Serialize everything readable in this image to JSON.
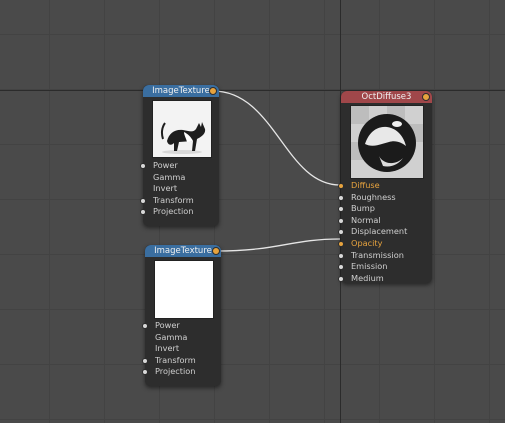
{
  "canvas": {
    "grid": true
  },
  "colors": {
    "texture_header": "#3a6ea0",
    "material_header": "#a0474a",
    "active_pin": "#e7a33e",
    "wire": "#e6e6e6"
  },
  "nodes": {
    "image_texture_1": {
      "title": "ImageTexture",
      "preview": "cat-photo-thumbnail",
      "pins": [
        "Power",
        "Gamma",
        "Invert",
        "Transform",
        "Projection"
      ]
    },
    "image_texture_2": {
      "title": "ImageTexture",
      "preview": "blank-white-thumbnail",
      "pins": [
        "Power",
        "Gamma",
        "Invert",
        "Transform",
        "Projection"
      ]
    },
    "oct_diffuse": {
      "title": "OctDiffuse3",
      "preview": "material-sphere-preview",
      "pins": [
        "Diffuse",
        "Roughness",
        "Bump",
        "Normal",
        "Displacement",
        "Opacity",
        "Transmission",
        "Emission",
        "Medium"
      ]
    }
  },
  "connections": [
    {
      "from": "ImageTexture",
      "to": "Diffuse"
    },
    {
      "from": "ImageTexture",
      "to": "Opacity"
    }
  ]
}
